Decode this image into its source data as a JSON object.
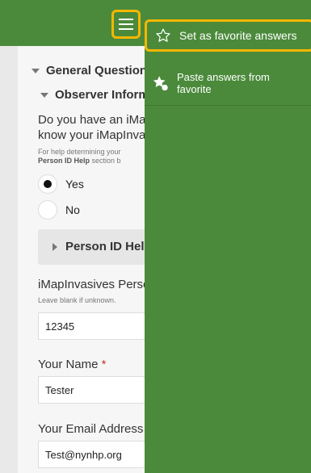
{
  "form": {
    "general_section": "General Questions",
    "observer_section": "Observer Information",
    "question_line1": "Do you have an iMapInvasives",
    "question_line2": "know your iMapInvasives",
    "help_line1": "For help determining your",
    "help_bold": "Person ID Help",
    "help_line2_rest": " section b",
    "options": {
      "yes": "Yes",
      "no": "No"
    },
    "person_id_help": "Person ID Help",
    "person_id_label": "iMapInvasives Person ID",
    "person_id_hint": "Leave blank if unknown.",
    "person_id_value": "12345",
    "name_label": "Your Name",
    "required_mark": "*",
    "name_value": "Tester",
    "email_label": "Your Email Address",
    "email_value": "Test@nynhp.org"
  },
  "drawer": {
    "favorite_label": "Set as favorite answers",
    "paste_label_line1": "Paste answers from",
    "paste_label_line2": "favorite"
  },
  "icons": {
    "menu": "hamburger-icon",
    "favorite": "star-outline-icon",
    "paste": "star-paste-icon"
  },
  "colors": {
    "header": "#4b8a3b",
    "highlight": "#f5b700",
    "form_bg": "#f6f6f6"
  }
}
